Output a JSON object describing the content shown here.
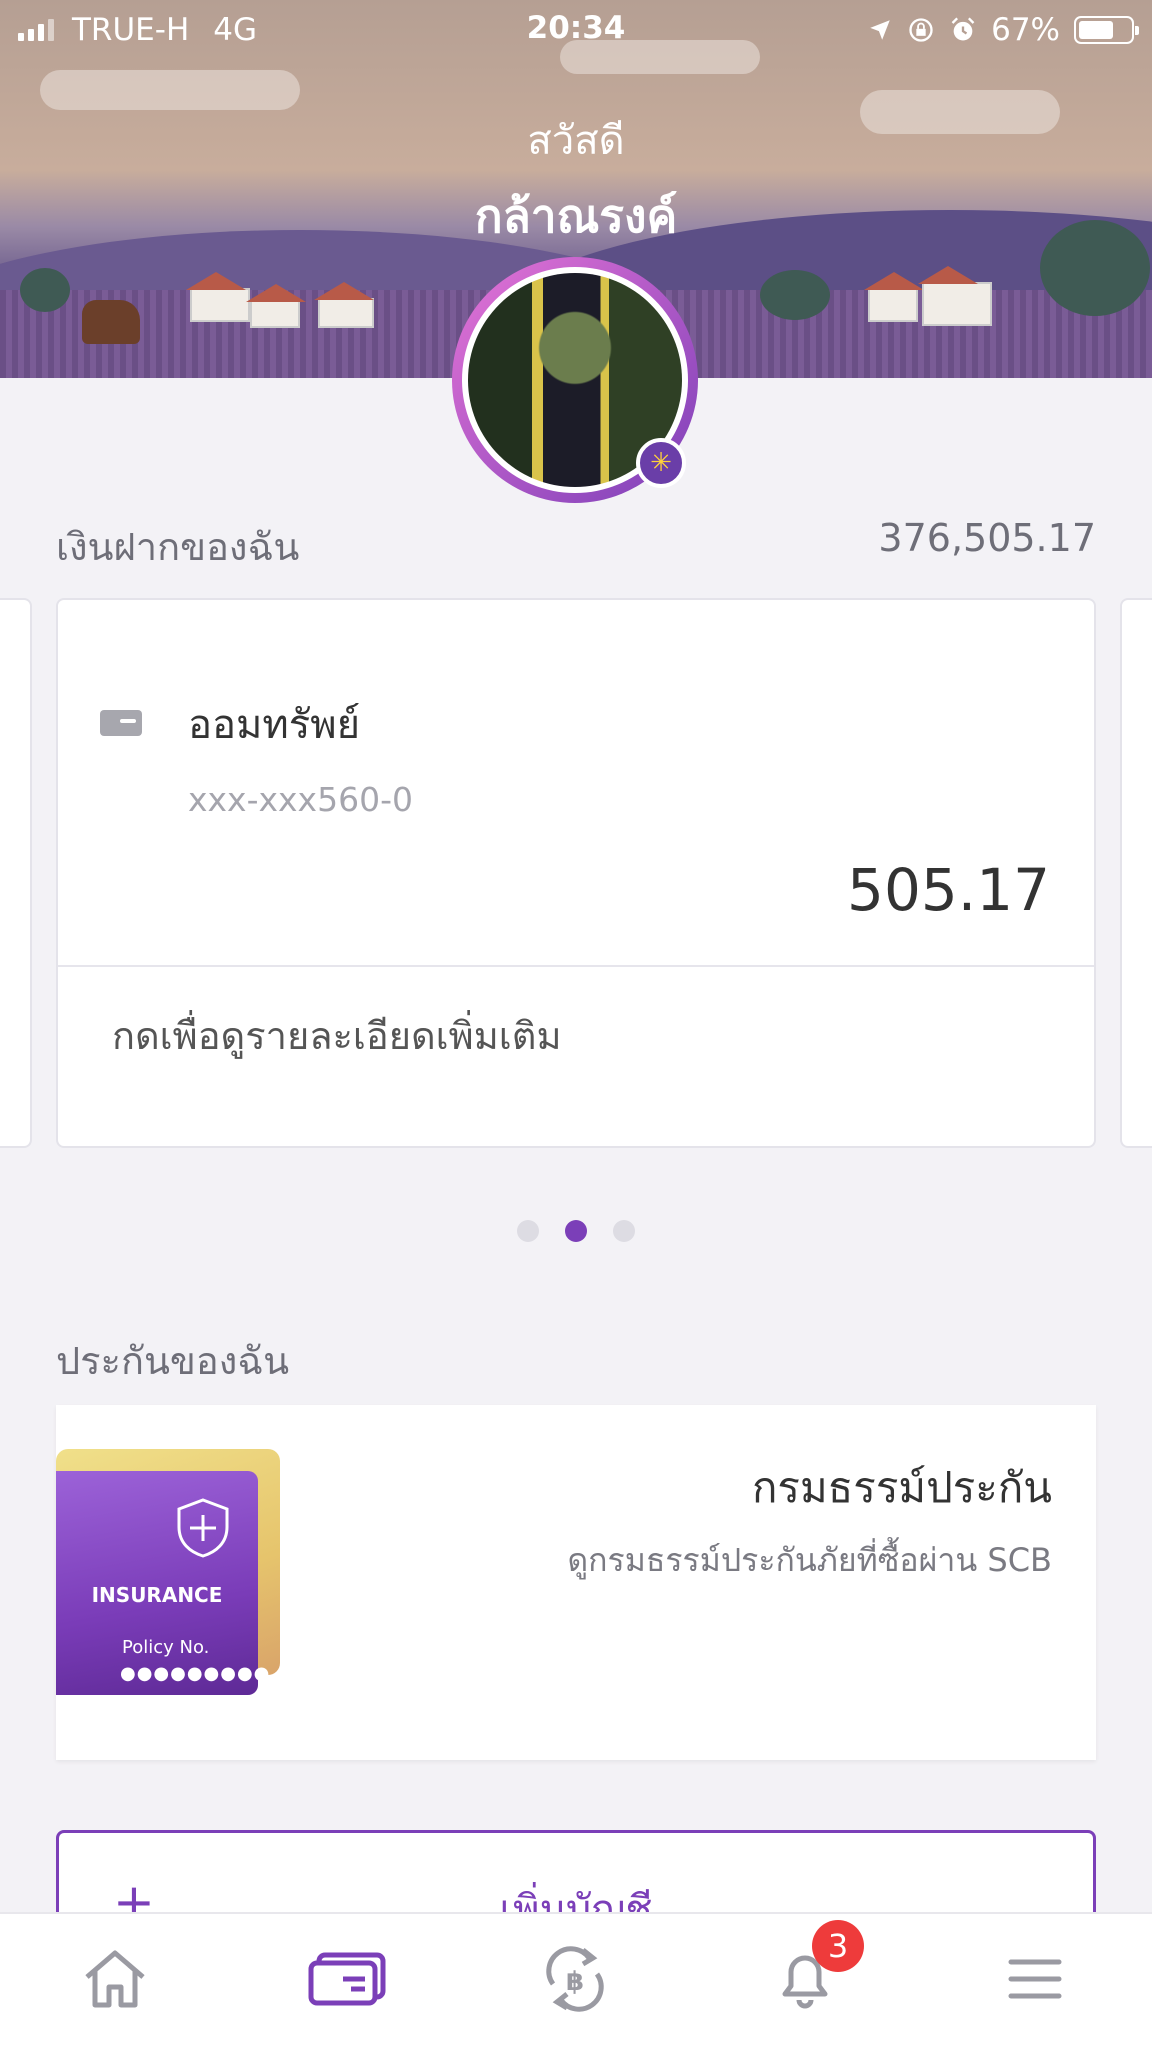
{
  "status_bar": {
    "carrier": "TRUE-H",
    "network": "4G",
    "time": "20:34",
    "battery": "67%",
    "battery_level": 0.67
  },
  "header": {
    "greeting": "สวัสดี",
    "name": "กล้าณรงค์"
  },
  "deposits": {
    "label": "เงินฝากของฉัน",
    "total": "376,505.17",
    "account": {
      "name": "ออมทรัพย์",
      "number": "xxx-xxx560-0",
      "balance": "505.17",
      "details_link": "กดเพื่อดูรายละเอียดเพิ่มเติม"
    },
    "pager": {
      "count": 3,
      "active": 1
    }
  },
  "insurance": {
    "label": "ประกันของฉัน",
    "card_word": "INSURANCE",
    "card_policy": "Policy No.",
    "card_dots": "●●●●●●●●●",
    "title": "กรมธรรม์ประกัน",
    "subtitle": "ดูกรมธรรม์ประกันภัยที่ซื้อผ่าน SCB"
  },
  "add_account": {
    "plus": "+",
    "label": "เพิ่มบัญชี"
  },
  "tabbar": {
    "items": [
      "home-icon",
      "accounts-icon",
      "transfer-icon",
      "bell-icon",
      "menu-icon"
    ],
    "active": 1,
    "notification_count": "3"
  },
  "colors": {
    "accent": "#7b3fb8",
    "badge": "#ee3b3b",
    "inactive_icon": "#9a9aa2"
  }
}
